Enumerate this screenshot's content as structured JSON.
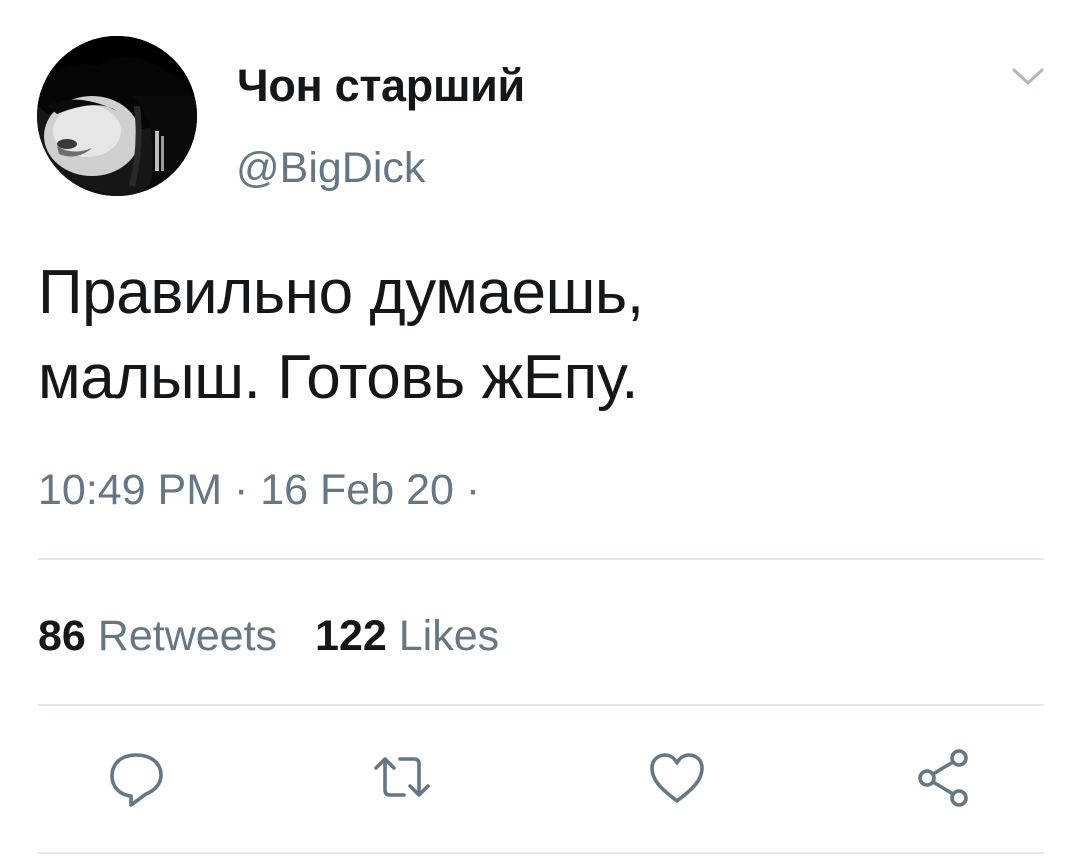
{
  "tweet": {
    "author": {
      "display_name": "Чон старший",
      "handle": "@BigDick",
      "avatar_icon": "user-avatar-photo"
    },
    "menu_icon": "chevron-down-icon",
    "text_lines": [
      "Правильно думаешь,",
      "малыш. Готовь жЕпу."
    ],
    "meta": "10:49 PM · 16 Feb 20 ·",
    "stats": {
      "retweets": {
        "count": "86",
        "label": "Retweets"
      },
      "likes": {
        "count": "122",
        "label": "Likes"
      }
    },
    "actions": [
      {
        "name": "reply",
        "icon": "reply-icon"
      },
      {
        "name": "retweet",
        "icon": "retweet-icon"
      },
      {
        "name": "like",
        "icon": "heart-icon"
      },
      {
        "name": "share",
        "icon": "share-icon"
      }
    ],
    "colors": {
      "text_primary": "#14171a",
      "text_secondary": "#657786",
      "divider": "#e1e8ed",
      "icon": "#657786"
    }
  }
}
